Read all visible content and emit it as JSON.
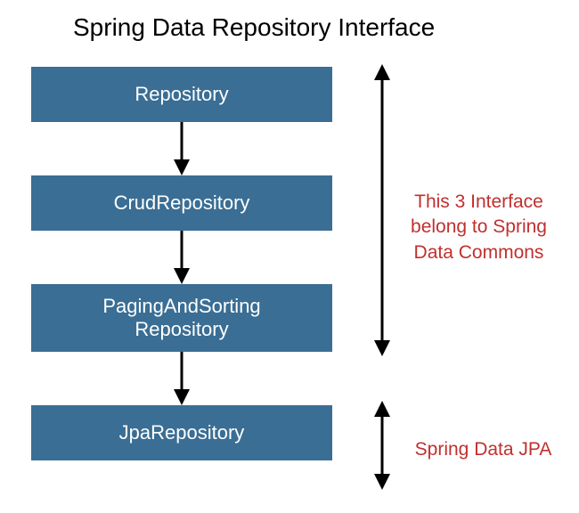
{
  "title": "Spring Data Repository Interface",
  "boxes": {
    "b1": "Repository",
    "b2": "CrudRepository",
    "b3_line1": "PagingAndSorting",
    "b3_line2": "Repository",
    "b4": "JpaRepository"
  },
  "annotations": {
    "commons_line1": "This 3 Interface",
    "commons_line2": "belong to Spring",
    "commons_line3": "Data Commons",
    "jpa": "Spring Data JPA"
  },
  "colors": {
    "box_bg": "#3a6e94",
    "box_text": "#ffffff",
    "annotation_text": "#c0302e",
    "title_text": "#000000",
    "arrow": "#000000"
  }
}
